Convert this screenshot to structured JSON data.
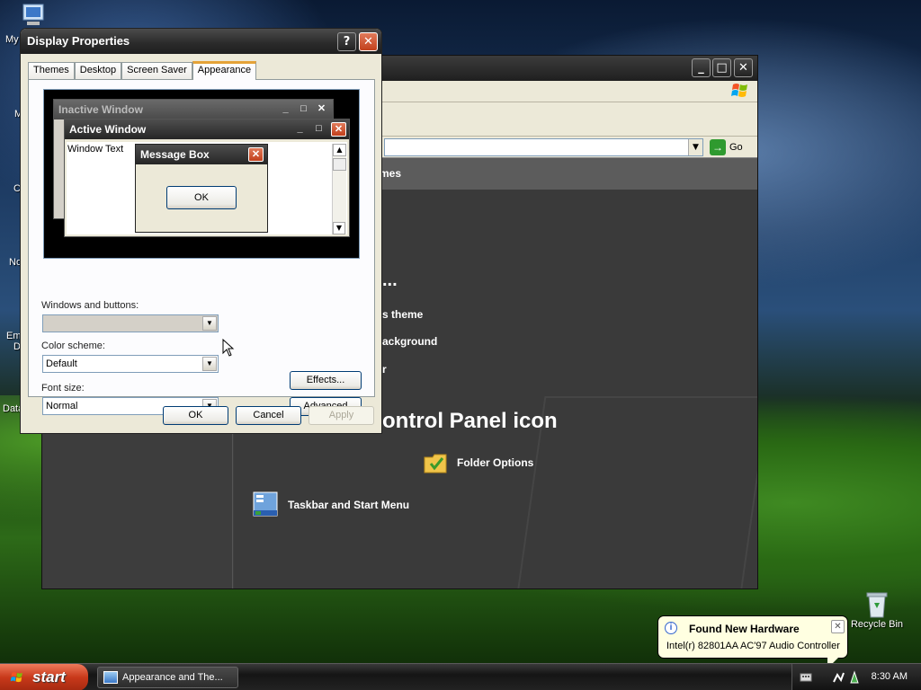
{
  "desktop": {
    "icons": [
      {
        "label": "My"
      },
      {
        "label": "M"
      },
      {
        "label": "C"
      },
      {
        "label": "No"
      },
      {
        "label": "Em"
      },
      {
        "label": "D"
      },
      {
        "label": "Data"
      }
    ],
    "recycle_bin": "Recycle Bin"
  },
  "control_panel": {
    "address_go": "Go",
    "side_heading_fragment": "mes",
    "pick_task_fragment": "...",
    "tasks": [
      "s theme",
      "ackground",
      "r"
    ],
    "pick_icon_fragment": "ontrol Panel icon",
    "icons": [
      {
        "label": "Folder Options",
        "icon": "folder-options-icon"
      },
      {
        "label": "Taskbar and Start Menu",
        "icon": "taskbar-icon"
      }
    ]
  },
  "display_properties": {
    "title": "Display Properties",
    "tabs": [
      "Themes",
      "Desktop",
      "Screen Saver",
      "Appearance"
    ],
    "active_tab": "Appearance",
    "preview": {
      "inactive_title": "Inactive Window",
      "active_title": "Active Window",
      "window_text": "Window Text",
      "message_title": "Message Box",
      "ok": "OK"
    },
    "windows_and_buttons_label": "Windows and buttons:",
    "windows_and_buttons_value": "",
    "color_scheme_label": "Color scheme:",
    "color_scheme_value": "Default",
    "font_size_label": "Font size:",
    "font_size_value": "Normal",
    "effects_label": "Effects...",
    "advanced_label": "Advanced",
    "ok_label": "OK",
    "cancel_label": "Cancel",
    "apply_label": "Apply"
  },
  "balloon": {
    "title": "Found New Hardware",
    "body": "Intel(r) 82801AA AC'97 Audio Controller"
  },
  "taskbar": {
    "start_label": "start",
    "task_button": "Appearance and The...",
    "clock": "8:30 AM"
  },
  "colors": {
    "accent_close": "#c2401c",
    "tab_highlight": "#e5a338",
    "balloon_bg": "#ffffe1"
  }
}
